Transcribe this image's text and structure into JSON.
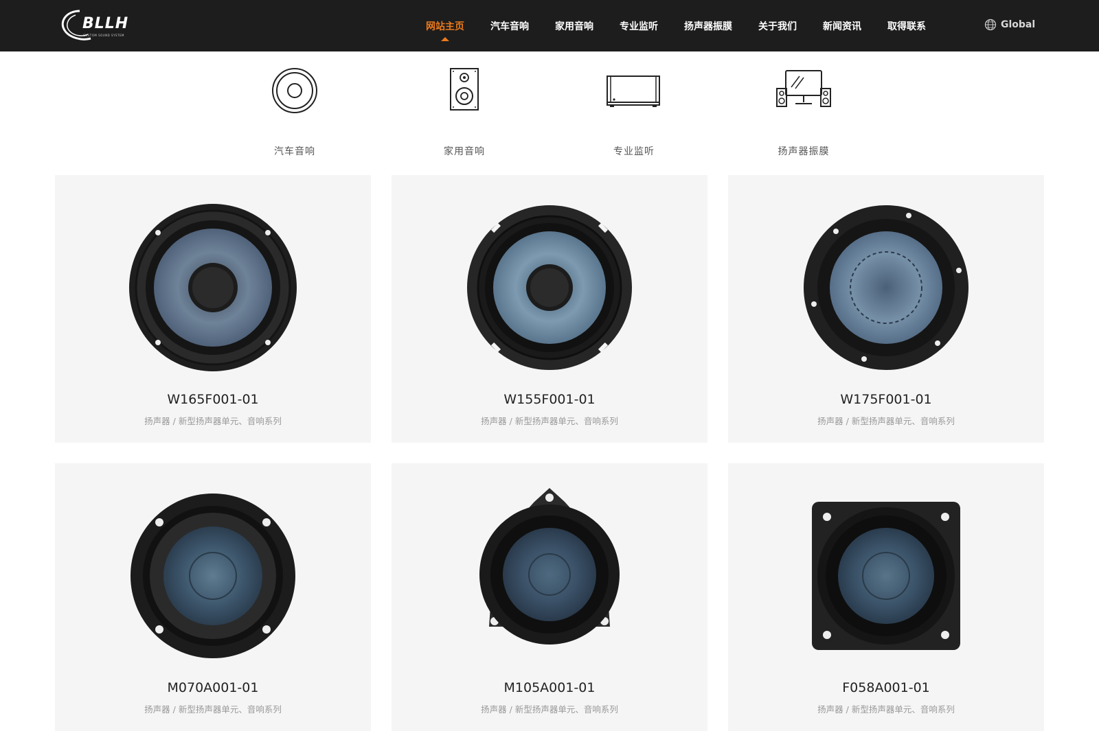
{
  "header": {
    "logo_text": "BLLH",
    "logo_subtext": "CUSTOM SOUND SYSTEM",
    "nav": [
      {
        "label": "网站主页",
        "active": true
      },
      {
        "label": "汽车音响",
        "active": false
      },
      {
        "label": "家用音响",
        "active": false
      },
      {
        "label": "专业监听",
        "active": false
      },
      {
        "label": "扬声器振膜",
        "active": false
      },
      {
        "label": "关于我们",
        "active": false
      },
      {
        "label": "新闻资讯",
        "active": false
      },
      {
        "label": "取得联系",
        "active": false
      }
    ],
    "global_label": "Global",
    "accent_color": "#ec7a1c",
    "bg_color": "#1d1d1d"
  },
  "categories": [
    {
      "label": "汽车音响",
      "icon": "speaker-driver-icon"
    },
    {
      "label": "家用音响",
      "icon": "speaker-cabinet-icon"
    },
    {
      "label": "专业监听",
      "icon": "amplifier-icon"
    },
    {
      "label": "扬声器振膜",
      "icon": "monitor-speakers-icon"
    }
  ],
  "products": [
    {
      "name": "W165F001-01",
      "category": "扬声器 / 新型扬声器单元、音响系列"
    },
    {
      "name": "W155F001-01",
      "category": "扬声器 / 新型扬声器单元、音响系列"
    },
    {
      "name": "W175F001-01",
      "category": "扬声器 / 新型扬声器单元、音响系列"
    },
    {
      "name": "M070A001-01",
      "category": "扬声器 / 新型扬声器单元、音响系列"
    },
    {
      "name": "M105A001-01",
      "category": "扬声器 / 新型扬声器单元、音响系列"
    },
    {
      "name": "F058A001-01",
      "category": "扬声器 / 新型扬声器单元、音响系列"
    }
  ]
}
